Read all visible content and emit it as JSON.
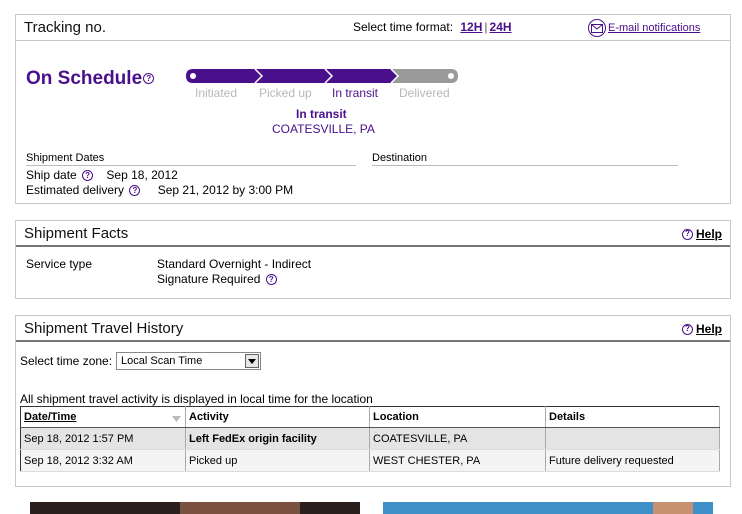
{
  "overview": {
    "title": "Tracking no.",
    "time_format_label": "Select time format:",
    "time_format_12h": "12H",
    "time_format_sep": "|",
    "time_format_24h": "24H",
    "email_notifications": "E-mail notifications",
    "status_headline": "On Schedule",
    "steps": [
      "Initiated",
      "Picked up",
      "In transit",
      "Delivered"
    ],
    "current_step_index": 2,
    "current_status": "In transit",
    "current_location": "COATESVILLE, PA",
    "shipment_dates_label": "Shipment Dates",
    "destination_label": "Destination",
    "ship_date_label": "Ship date",
    "ship_date_value": "Sep 18, 2012",
    "estimated_delivery_label": "Estimated delivery",
    "estimated_delivery_value": "Sep 21, 2012 by 3:00 PM"
  },
  "facts": {
    "title": "Shipment Facts",
    "help": "Help",
    "service_type_label": "Service type",
    "service_type_value": "Standard Overnight - Indirect",
    "signature": "Signature Required"
  },
  "history": {
    "title": "Shipment Travel History",
    "help": "Help",
    "time_zone_label": "Select time zone:",
    "time_zone_value": "Local Scan Time",
    "note": "All shipment travel activity is displayed in local time for the location",
    "columns": [
      "Date/Time",
      "Activity",
      "Location",
      "Details"
    ],
    "rows": [
      {
        "datetime": "Sep 18, 2012 1:57 PM",
        "activity": "Left FedEx origin facility",
        "location": "COATESVILLE, PA",
        "details": ""
      },
      {
        "datetime": "Sep 18, 2012 3:32 AM",
        "activity": "Picked up",
        "location": "WEST CHESTER, PA",
        "details": "Future delivery requested"
      }
    ]
  },
  "colors": {
    "brand_purple": "#4a0f8a",
    "progress_gray": "#9a9a9a"
  }
}
